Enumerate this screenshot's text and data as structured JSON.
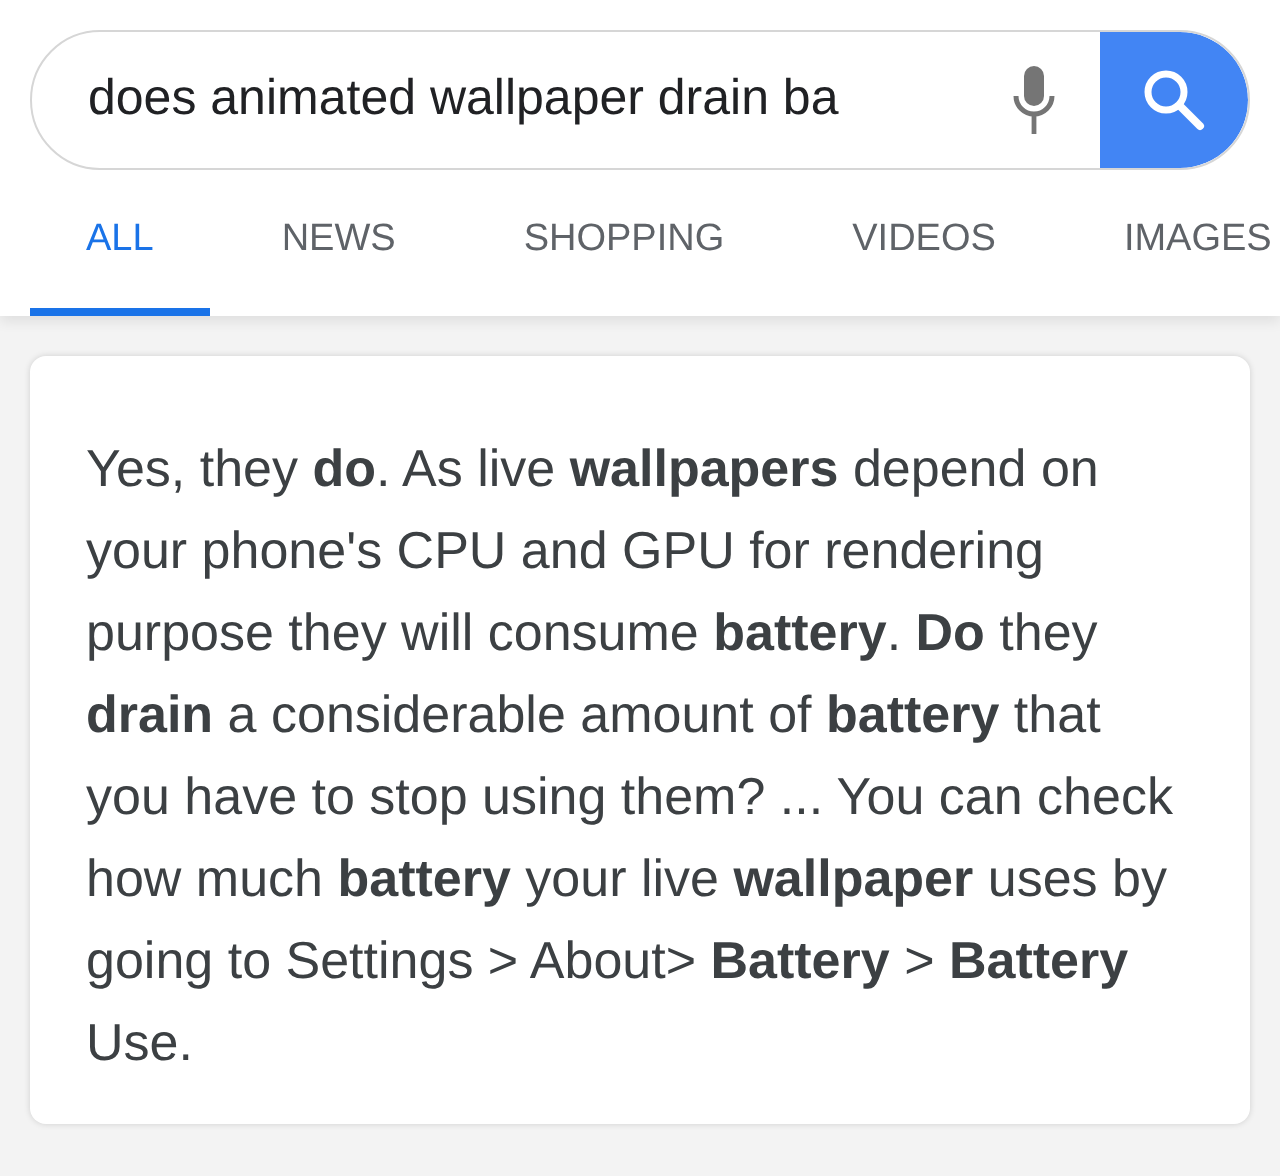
{
  "search": {
    "value": "does animated wallpaper drain ba"
  },
  "tabs": [
    {
      "label": "ALL",
      "selected": true
    },
    {
      "label": "NEWS",
      "selected": false
    },
    {
      "label": "SHOPPING",
      "selected": false
    },
    {
      "label": "VIDEOS",
      "selected": false
    },
    {
      "label": "IMAGES",
      "selected": false
    }
  ],
  "answer": {
    "text": "Yes, they **do**. As live **wallpapers** depend on your phone's CPU and GPU for rendering purpose they will consume **battery**. **Do** they **drain** a considerable amount of **battery** that you have to stop using them? ... You can check how much **battery** your live **wallpaper** uses by going to Settings > About> **Battery** > **Battery** Use."
  }
}
